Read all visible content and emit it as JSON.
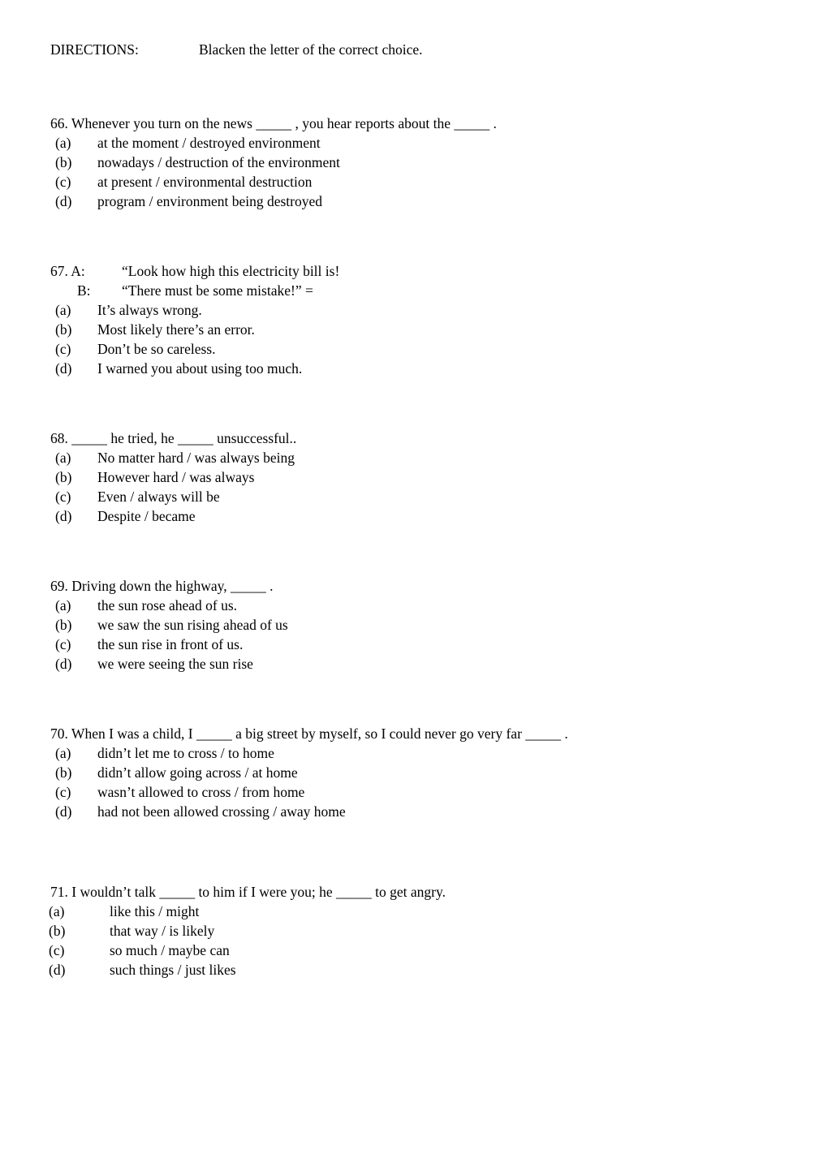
{
  "directions": {
    "label": "DIRECTIONS:",
    "text": "Blacken the letter of the correct choice."
  },
  "questions": [
    {
      "number": "66.",
      "stem": "66. Whenever you turn on the news _____ , you hear reports about the _____ .",
      "options": [
        {
          "label": "(a)",
          "text": "at the moment / destroyed environment"
        },
        {
          "label": "(b)",
          "text": "nowadays / destruction of the environment"
        },
        {
          "label": "(c)",
          "text": "at present / environmental destruction"
        },
        {
          "label": "(d)",
          "text": "program / environment being destroyed"
        }
      ]
    },
    {
      "number": "67.",
      "dialogue": [
        {
          "prefix": "67. A:",
          "speaker": "A:",
          "line": "“Look how high this electricity bill is!"
        },
        {
          "prefix": "B:",
          "speaker": "B:",
          "line": "“There must be some mistake!” ="
        }
      ],
      "options": [
        {
          "label": "(a)",
          "text": "It’s always wrong."
        },
        {
          "label": "(b)",
          "text": "Most likely there’s an error."
        },
        {
          "label": "(c)",
          "text": "Don’t be so careless."
        },
        {
          "label": "(d)",
          "text": "I warned you about using too much."
        }
      ]
    },
    {
      "number": "68.",
      "stem": "68. _____ he tried, he _____ unsuccessful..",
      "options": [
        {
          "label": "(a)",
          "text": "No matter hard / was always being"
        },
        {
          "label": "(b)",
          "text": "However hard / was always"
        },
        {
          "label": "(c)",
          "text": "Even / always will be"
        },
        {
          "label": "(d)",
          "text": "Despite / became"
        }
      ]
    },
    {
      "number": "69.",
      "stem": "69. Driving down the highway, _____ .",
      "options": [
        {
          "label": "(a)",
          "text": "the sun rose ahead of us."
        },
        {
          "label": "(b)",
          "text": "we saw the sun rising ahead of us"
        },
        {
          "label": "(c)",
          "text": "the sun rise in front of us."
        },
        {
          "label": "(d)",
          "text": "we were seeing the sun rise"
        }
      ]
    },
    {
      "number": "70.",
      "stem": "70. When I was a child, I _____ a big street by myself, so I could never go very far _____ .",
      "options": [
        {
          "label": "(a)",
          "text": "didn’t let me to cross / to home"
        },
        {
          "label": "(b)",
          "text": "didn’t allow going across / at home"
        },
        {
          "label": "(c)",
          "text": "wasn’t allowed to cross / from home"
        },
        {
          "label": "(d)",
          "text": "had not been allowed crossing / away home"
        }
      ]
    },
    {
      "number": "71.",
      "stem": "71. I wouldn’t talk _____ to him if I were you; he _____ to get angry.",
      "options": [
        {
          "label": "(a)",
          "text": "like this / might"
        },
        {
          "label": "(b)",
          "text": "that way / is likely"
        },
        {
          "label": "(c)",
          "text": "so much / maybe can"
        },
        {
          "label": "(d)",
          "text": "such things / just likes"
        }
      ]
    }
  ]
}
